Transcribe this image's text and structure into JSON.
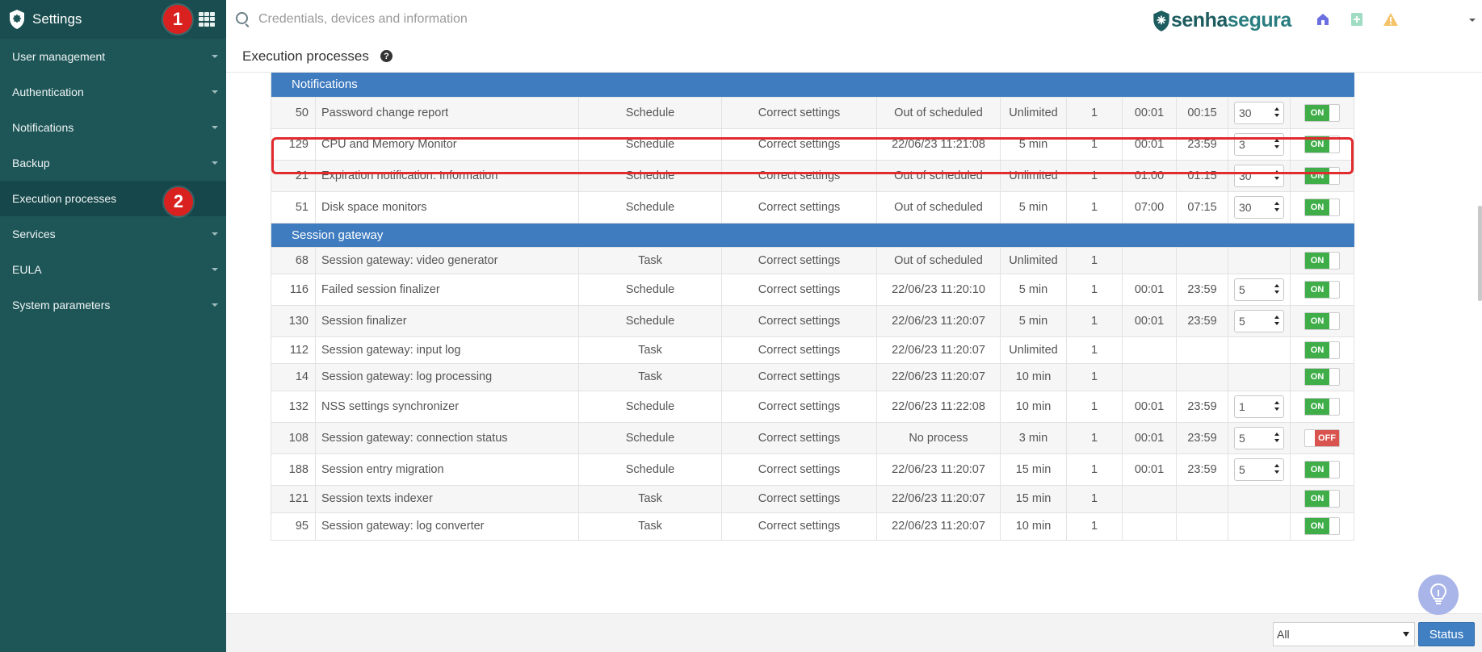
{
  "sidebar": {
    "title": "Settings",
    "badge1": "1",
    "badge2": "2",
    "items": [
      {
        "label": "User management"
      },
      {
        "label": "Authentication"
      },
      {
        "label": "Notifications"
      },
      {
        "label": "Backup"
      },
      {
        "label": "Execution processes"
      },
      {
        "label": "Services"
      },
      {
        "label": "EULA"
      },
      {
        "label": "System parameters"
      }
    ]
  },
  "topbar": {
    "search_placeholder": "Credentials, devices and information",
    "brand_part1": "senha",
    "brand_part2": "segura"
  },
  "page": {
    "title": "Execution processes",
    "help": "?"
  },
  "groups": [
    {
      "name": "Notifications",
      "rows": [
        {
          "id": "50",
          "name": "Password change report",
          "type": "Schedule",
          "status": "Correct settings",
          "last": "Out of scheduled",
          "timeout": "Unlimited",
          "instances": "1",
          "start": "00:01",
          "end": "00:15",
          "interval": "30",
          "enabled": "ON"
        },
        {
          "id": "129",
          "name": "CPU and Memory Monitor",
          "type": "Schedule",
          "status": "Correct settings",
          "last": "22/06/23 11:21:08",
          "timeout": "5 min",
          "instances": "1",
          "start": "00:01",
          "end": "23:59",
          "interval": "3",
          "enabled": "ON"
        },
        {
          "id": "21",
          "name": "Expiration notification: Information",
          "type": "Schedule",
          "status": "Correct settings",
          "last": "Out of scheduled",
          "timeout": "Unlimited",
          "instances": "1",
          "start": "01:00",
          "end": "01:15",
          "interval": "30",
          "enabled": "ON"
        },
        {
          "id": "51",
          "name": "Disk space monitors",
          "type": "Schedule",
          "status": "Correct settings",
          "last": "Out of scheduled",
          "timeout": "5 min",
          "instances": "1",
          "start": "07:00",
          "end": "07:15",
          "interval": "30",
          "enabled": "ON"
        }
      ]
    },
    {
      "name": "Session gateway",
      "rows": [
        {
          "id": "68",
          "name": "Session gateway: video generator",
          "type": "Task",
          "status": "Correct settings",
          "last": "Out of scheduled",
          "timeout": "Unlimited",
          "instances": "1",
          "start": "",
          "end": "",
          "interval": "",
          "enabled": "ON"
        },
        {
          "id": "116",
          "name": "Failed session finalizer",
          "type": "Schedule",
          "status": "Correct settings",
          "last": "22/06/23 11:20:10",
          "timeout": "5 min",
          "instances": "1",
          "start": "00:01",
          "end": "23:59",
          "interval": "5",
          "enabled": "ON"
        },
        {
          "id": "130",
          "name": "Session finalizer",
          "type": "Schedule",
          "status": "Correct settings",
          "last": "22/06/23 11:20:07",
          "timeout": "5 min",
          "instances": "1",
          "start": "00:01",
          "end": "23:59",
          "interval": "5",
          "enabled": "ON"
        },
        {
          "id": "112",
          "name": "Session gateway: input log",
          "type": "Task",
          "status": "Correct settings",
          "last": "22/06/23 11:20:07",
          "timeout": "Unlimited",
          "instances": "1",
          "start": "",
          "end": "",
          "interval": "",
          "enabled": "ON"
        },
        {
          "id": "14",
          "name": "Session gateway: log processing",
          "type": "Task",
          "status": "Correct settings",
          "last": "22/06/23 11:20:07",
          "timeout": "10 min",
          "instances": "1",
          "start": "",
          "end": "",
          "interval": "",
          "enabled": "ON"
        },
        {
          "id": "132",
          "name": "NSS settings synchronizer",
          "type": "Schedule",
          "status": "Correct settings",
          "last": "22/06/23 11:22:08",
          "timeout": "10 min",
          "instances": "1",
          "start": "00:01",
          "end": "23:59",
          "interval": "1",
          "enabled": "ON"
        },
        {
          "id": "108",
          "name": "Session gateway: connection status",
          "type": "Schedule",
          "status": "Correct settings",
          "last": "No process",
          "timeout": "3 min",
          "instances": "1",
          "start": "00:01",
          "end": "23:59",
          "interval": "5",
          "enabled": "OFF"
        },
        {
          "id": "188",
          "name": "Session entry migration",
          "type": "Schedule",
          "status": "Correct settings",
          "last": "22/06/23 11:20:07",
          "timeout": "15 min",
          "instances": "1",
          "start": "00:01",
          "end": "23:59",
          "interval": "5",
          "enabled": "ON"
        },
        {
          "id": "121",
          "name": "Session texts indexer",
          "type": "Task",
          "status": "Correct settings",
          "last": "22/06/23 11:20:07",
          "timeout": "15 min",
          "instances": "1",
          "start": "",
          "end": "",
          "interval": "",
          "enabled": "ON"
        },
        {
          "id": "95",
          "name": "Session gateway: log converter",
          "type": "Task",
          "status": "Correct settings",
          "last": "22/06/23 11:20:07",
          "timeout": "10 min",
          "instances": "1",
          "start": "",
          "end": "",
          "interval": "",
          "enabled": "ON"
        }
      ]
    }
  ],
  "footer": {
    "filter_value": "All",
    "status_button": "Status"
  },
  "colors": {
    "sidebar": "#1e5658",
    "group_header": "#3e7bbf",
    "toggle_on": "#3fae49",
    "toggle_off": "#d9534f",
    "highlight": "#e02b2f"
  }
}
